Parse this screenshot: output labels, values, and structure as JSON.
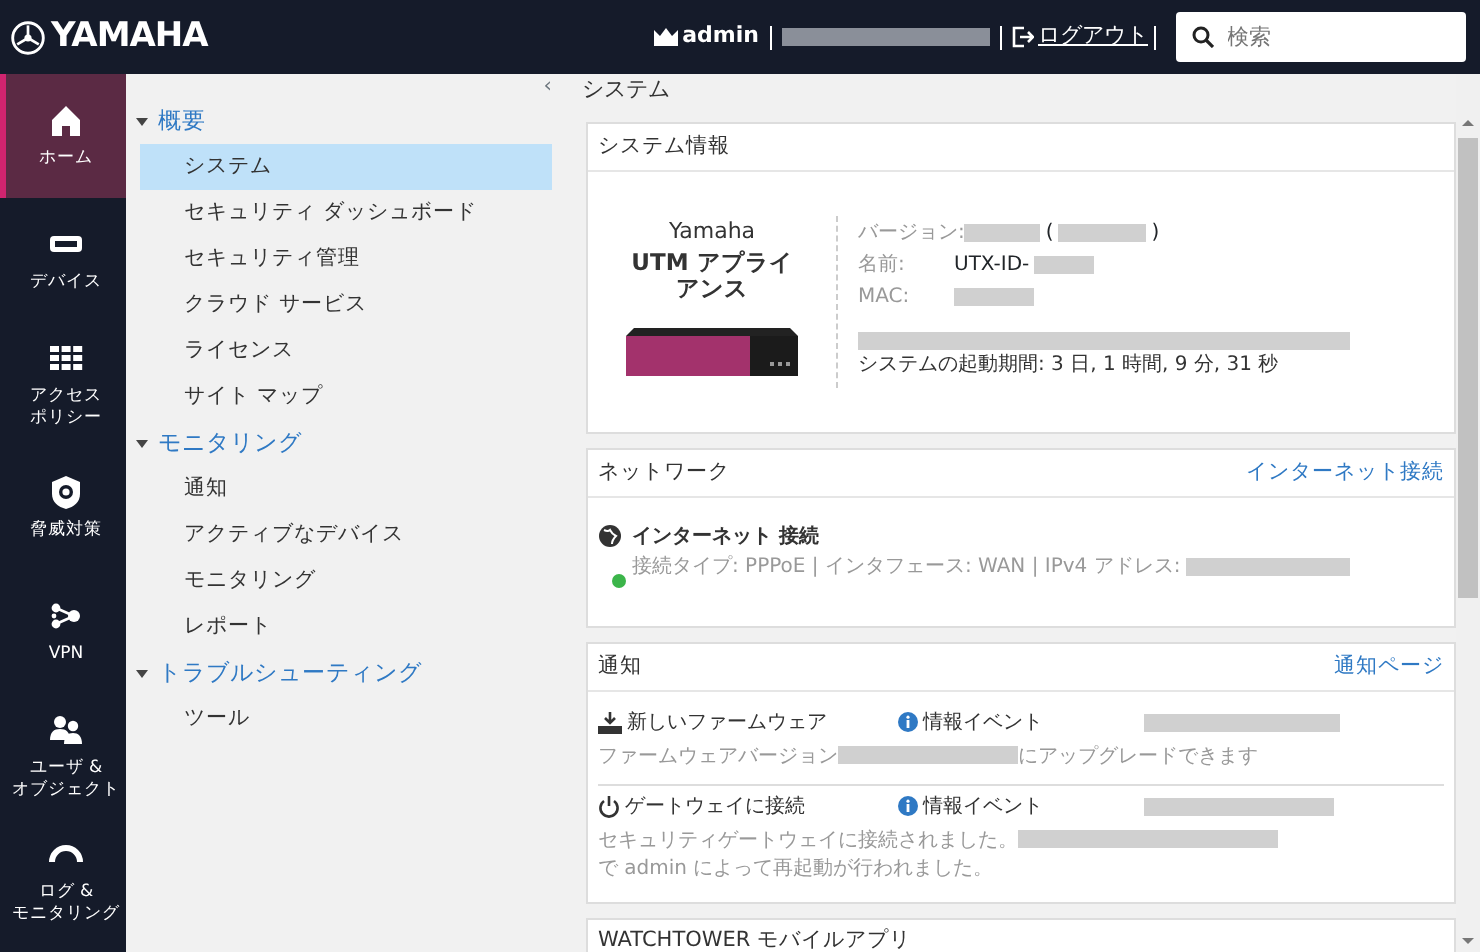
{
  "header": {
    "brand": "YAMAHA",
    "user": "admin",
    "logout": "ログアウト",
    "search": {
      "placeholder": "検索"
    }
  },
  "rail": [
    {
      "label_lines": [
        "ホーム"
      ],
      "selected": true
    },
    {
      "label_lines": [
        "デバイス"
      ],
      "selected": false
    },
    {
      "label_lines": [
        "アクセス",
        "ポリシー"
      ],
      "selected": false
    },
    {
      "label_lines": [
        "脅威対策"
      ],
      "selected": false
    },
    {
      "label_lines": [
        "VPN"
      ],
      "selected": false
    },
    {
      "label_lines": [
        "ユーザ &",
        "オブジェクト"
      ],
      "selected": false
    },
    {
      "label_lines": [
        "ログ &",
        "モニタリング"
      ],
      "selected": false
    }
  ],
  "nav": {
    "collapse": "‹",
    "sections": [
      {
        "title": "概要",
        "expanded": true,
        "items": [
          {
            "label": "システム",
            "selected": true
          },
          {
            "label": "セキュリティ ダッシュボード",
            "selected": false
          },
          {
            "label": "セキュリティ管理",
            "selected": false
          },
          {
            "label": "クラウド サービス",
            "selected": false
          },
          {
            "label": "ライセンス",
            "selected": false
          },
          {
            "label": "サイト マップ",
            "selected": false
          }
        ]
      },
      {
        "title": "モニタリング",
        "expanded": true,
        "items": [
          {
            "label": "通知",
            "selected": false
          },
          {
            "label": "アクティブなデバイス",
            "selected": false
          },
          {
            "label": "モニタリング",
            "selected": false
          },
          {
            "label": "レポート",
            "selected": false
          }
        ]
      },
      {
        "title": "トラブルシューティング",
        "expanded": true,
        "items": [
          {
            "label": "ツール",
            "selected": false
          }
        ]
      }
    ]
  },
  "page_title": "システム",
  "system_info": {
    "title": "システム情報",
    "brand": "Yamaha",
    "model": "UTM アプライアンス",
    "fields": [
      {
        "label": "バージョン:",
        "parts": [
          {
            "kind": "redacted"
          },
          {
            "kind": "text",
            "text": "("
          },
          {
            "kind": "redacted"
          },
          {
            "kind": "text",
            "text": ")"
          }
        ]
      },
      {
        "label": "名前:",
        "parts": [
          {
            "kind": "text",
            "text": "UTX-ID-"
          },
          {
            "kind": "redacted"
          }
        ]
      },
      {
        "label": "MAC:",
        "parts": [
          {
            "kind": "redacted"
          }
        ]
      }
    ],
    "uptime": "システムの起動期間: 3 日, 1 時間, 9 分, 31 秒"
  },
  "network": {
    "title": "ネットワーク",
    "link": "インターネット接続",
    "connection": {
      "name": "インターネット 接続",
      "color": "#3bb54a",
      "details": "接続タイプ: PPPoE | インタフェース: WAN | IPv4 アドレス:"
    }
  },
  "notifications": {
    "title": "通知",
    "link": "通知ページ",
    "items": [
      {
        "kind": "firmware",
        "title": "新しいファームウェア",
        "type": "情報イベント",
        "message": [
          {
            "kind": "text",
            "text": "ファームウェアバージョン"
          },
          {
            "kind": "redacted"
          },
          {
            "kind": "text",
            "text": "にアップグレードできます"
          }
        ]
      },
      {
        "kind": "power",
        "title": "ゲートウェイに接続",
        "type": "情報イベント",
        "message": [
          {
            "kind": "text",
            "text": "セキュリティゲートウェイに接続されました。"
          },
          {
            "kind": "redacted"
          },
          {
            "kind": "text",
            "text": "で admin によって再起動が行われました。"
          }
        ]
      }
    ]
  },
  "watchtower": {
    "title": "WATCHTOWER モバイルアプリ"
  }
}
